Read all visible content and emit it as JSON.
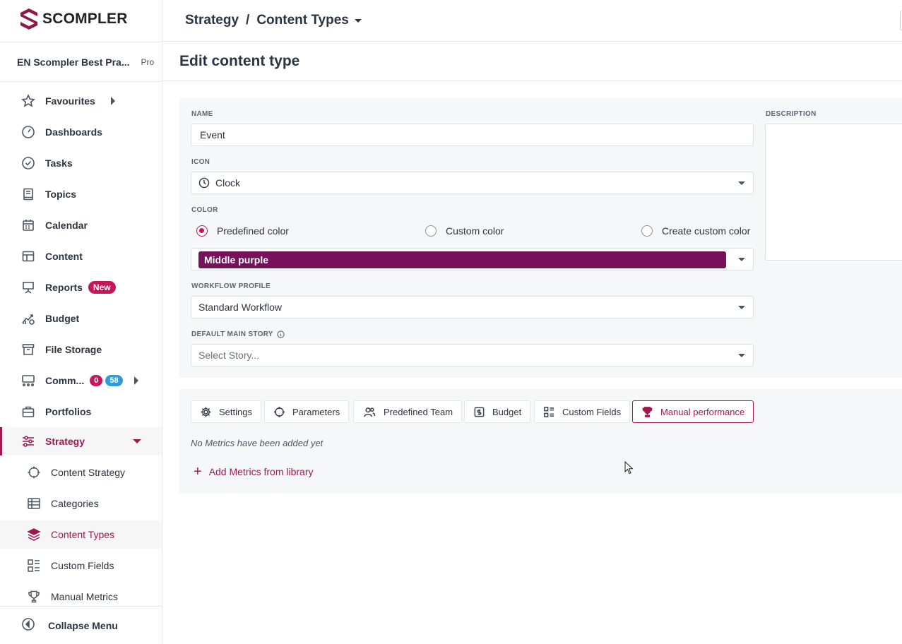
{
  "brand": {
    "name": "SCOMPLER",
    "accent": "#a3174f",
    "color_chip": "#76115a"
  },
  "account": {
    "name": "EN Scompler Best Pra...",
    "plan": "Pro"
  },
  "nav": {
    "favourites": "Favourites",
    "dashboards": "Dashboards",
    "tasks": "Tasks",
    "topics": "Topics",
    "calendar": "Calendar",
    "content": "Content",
    "reports": "Reports",
    "reports_badge": "New",
    "budget": "Budget",
    "file_storage": "File Storage",
    "comm": "Comm...",
    "comm_badge_red": "0",
    "comm_badge_blue": "58",
    "portfolios": "Portfolios",
    "strategy": "Strategy",
    "sub": {
      "content_strategy": "Content Strategy",
      "categories": "Categories",
      "content_types": "Content Types",
      "custom_fields": "Custom Fields",
      "manual_metrics": "Manual Metrics"
    },
    "collapse": "Collapse Menu"
  },
  "header": {
    "crumb_parent": "Strategy",
    "crumb_sep": "/",
    "crumb_current": "Content Types"
  },
  "page": {
    "title": "Edit content type"
  },
  "form": {
    "name_label": "NAME",
    "name_value": "Event",
    "icon_label": "ICON",
    "icon_value": "Clock",
    "color_label": "COLOR",
    "color_options": [
      "Predefined color",
      "Custom color",
      "Create custom color"
    ],
    "color_selected": "Predefined color",
    "color_value": "Middle purple",
    "workflow_label": "WORKFLOW PROFILE",
    "workflow_value": "Standard Workflow",
    "story_label": "DEFAULT MAIN STORY",
    "story_placeholder": "Select Story...",
    "description_label": "DESCRIPTION"
  },
  "tabs": {
    "settings": "Settings",
    "parameters": "Parameters",
    "predefined_team": "Predefined Team",
    "budget": "Budget",
    "custom_fields": "Custom Fields",
    "manual_performance": "Manual performance",
    "active": "Manual performance"
  },
  "metrics": {
    "empty": "No Metrics have been added yet",
    "add": "Add Metrics from library"
  }
}
